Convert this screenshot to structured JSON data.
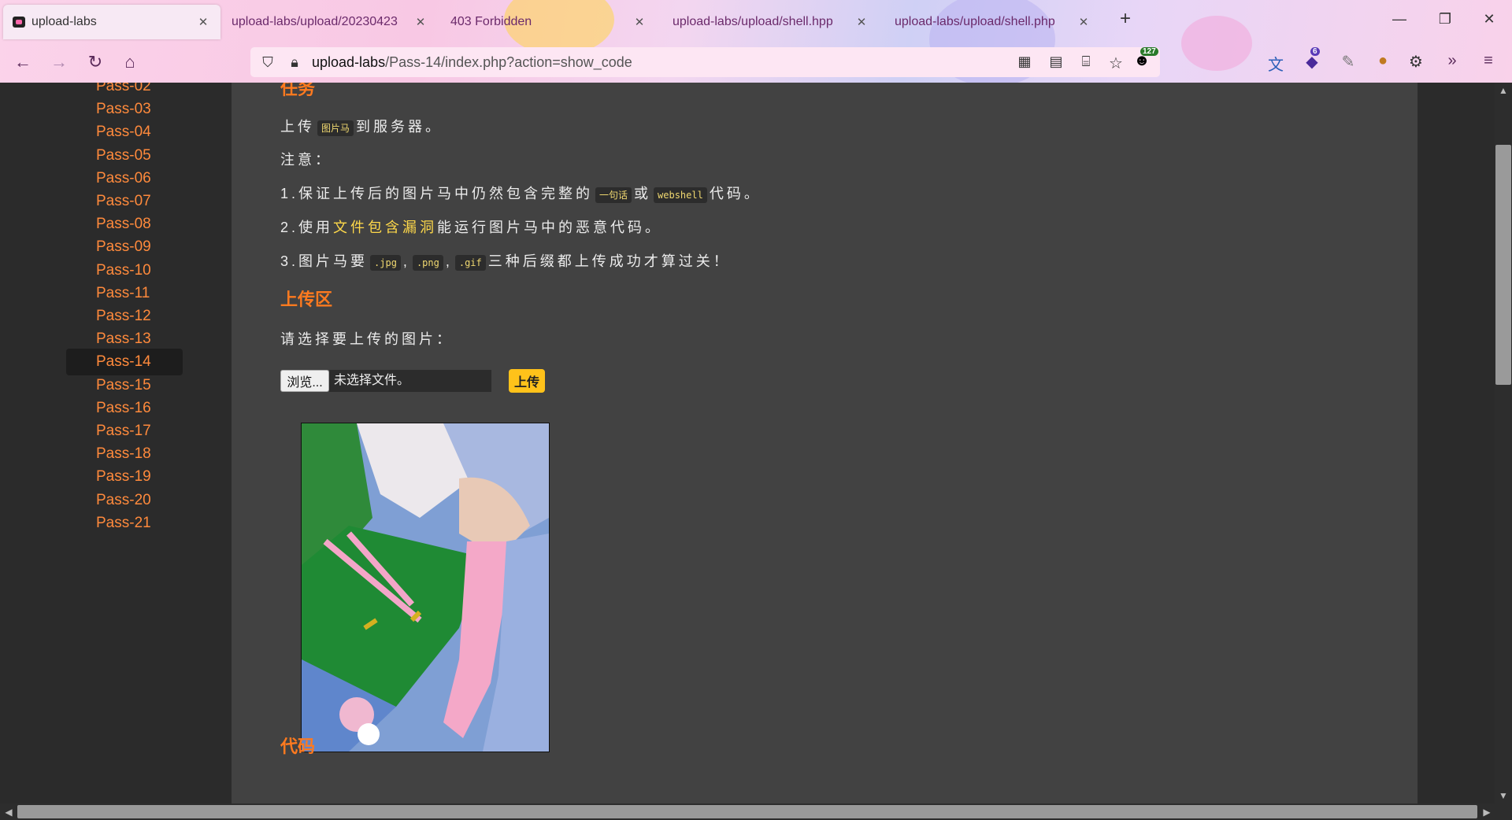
{
  "browser": {
    "tabs": [
      {
        "title": "upload-labs",
        "active": true
      },
      {
        "title": "upload-labs/upload/20230423",
        "active": false
      },
      {
        "title": "403 Forbidden",
        "active": false
      },
      {
        "title": "upload-labs/upload/shell.hpp",
        "active": false
      },
      {
        "title": "upload-labs/upload/shell.php",
        "active": false
      }
    ],
    "new_tab_label": "+",
    "url_host": "upload-labs",
    "url_path": "/Pass-14/index.php?action=show_code",
    "extension_badges": {
      "first": "127",
      "second": "6"
    }
  },
  "sidebar": {
    "items": [
      {
        "label": "Pass-02"
      },
      {
        "label": "Pass-03"
      },
      {
        "label": "Pass-04"
      },
      {
        "label": "Pass-05"
      },
      {
        "label": "Pass-06"
      },
      {
        "label": "Pass-07"
      },
      {
        "label": "Pass-08"
      },
      {
        "label": "Pass-09"
      },
      {
        "label": "Pass-10"
      },
      {
        "label": "Pass-11"
      },
      {
        "label": "Pass-12"
      },
      {
        "label": "Pass-13"
      },
      {
        "label": "Pass-14",
        "selected": true
      },
      {
        "label": "Pass-15"
      },
      {
        "label": "Pass-16"
      },
      {
        "label": "Pass-17"
      },
      {
        "label": "Pass-18"
      },
      {
        "label": "Pass-19"
      },
      {
        "label": "Pass-20"
      },
      {
        "label": "Pass-21"
      }
    ]
  },
  "main": {
    "task_heading": "任务",
    "task_line": {
      "pre": "上传",
      "code": "图片马",
      "post": "到服务器。"
    },
    "note_label": "注意：",
    "rule1": {
      "pre": "1.保证上传后的图片马中仍然包含完整的",
      "code1": "一句话",
      "mid": "或",
      "code2": "webshell",
      "post": "代码。"
    },
    "rule2": {
      "pre": "2.使用",
      "link": "文件包含漏洞",
      "post": "能运行图片马中的恶意代码。"
    },
    "rule3": {
      "pre": "3.图片马要",
      "code1": ".jpg",
      "sep1": ",",
      "code2": ".png",
      "sep2": ",",
      "code3": ".gif",
      "post": "三种后缀都上传成功才算过关！"
    },
    "upload_heading": "上传区",
    "choose_label": "请选择要上传的图片：",
    "browse_label": "浏览...",
    "file_placeholder": "未选择文件。",
    "upload_button": "上传",
    "code_heading": "代码"
  },
  "colors": {
    "accent": "#ff7a1f",
    "sidebar_link": "#ff8a3c",
    "highlight": "#ffd94a",
    "upload_button": "#ffc21a"
  }
}
